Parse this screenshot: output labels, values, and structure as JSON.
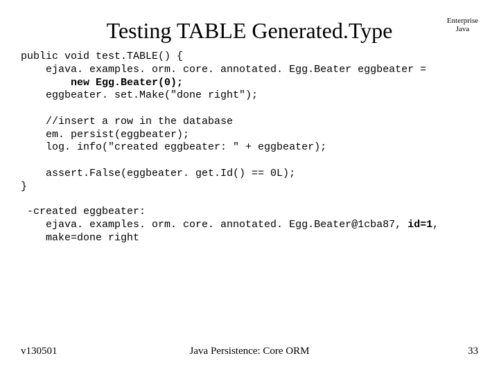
{
  "header": {
    "title": "Testing TABLE Generated.Type",
    "corner_line1": "Enterprise",
    "corner_line2": "Java"
  },
  "code": {
    "l1": "public void test.TABLE() {",
    "l2": "    ejava. examples. orm. core. annotated. Egg.Beater eggbeater =",
    "l3a": "        ",
    "l3b": "new Egg.Beater(0);",
    "l4": "    eggbeater. set.Make(\"done right\");",
    "l5": "",
    "l6": "    //insert a row in the database",
    "l7": "    em. persist(eggbeater);",
    "l8": "    log. info(\"created eggbeater: \" + eggbeater);",
    "l9": "",
    "l10": "    assert.False(eggbeater. get.Id() == 0L);",
    "l11": "}"
  },
  "output": {
    "l1": " -created eggbeater:",
    "l2a": "    ejava. examples. orm. core. annotated. Egg.Beater@1cba87, ",
    "l2b": "id=1",
    "l2c": ",",
    "l3": "    make=done right"
  },
  "footer": {
    "left": "v130501",
    "center": "Java Persistence: Core ORM",
    "right": "33"
  }
}
